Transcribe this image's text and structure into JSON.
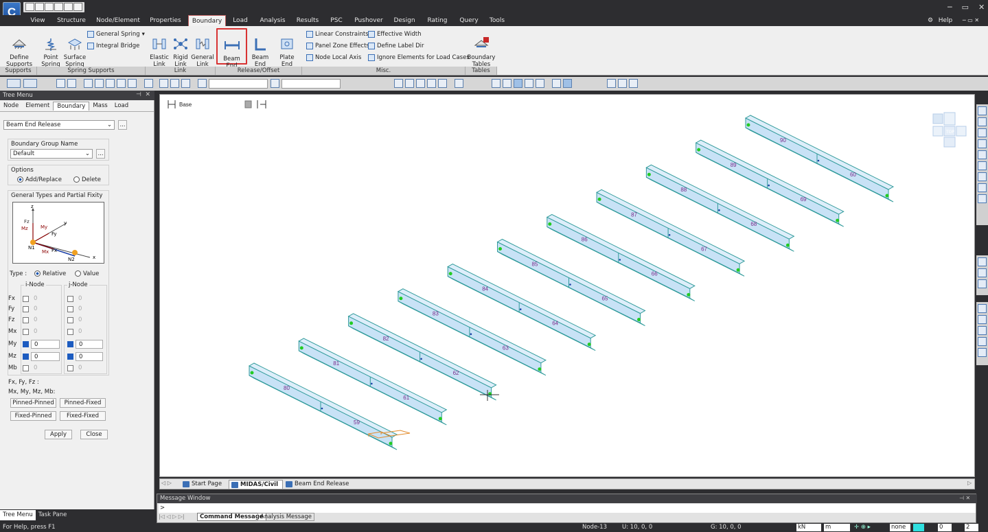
{
  "menu": {
    "items": [
      "View",
      "Structure",
      "Node/Element",
      "Properties",
      "Boundary",
      "Load",
      "Analysis",
      "Results",
      "PSC",
      "Pushover",
      "Design",
      "Rating",
      "Query",
      "Tools"
    ],
    "help": "Help"
  },
  "ribbon": {
    "define_supports": "Define\nSupports",
    "point_spring": "Point\nSpring",
    "surface_spring": "Surface\nSpring",
    "general_spring": "General Spring",
    "integral_bridge": "Integral Bridge",
    "elastic_link": "Elastic\nLink",
    "rigid_link": "Rigid\nLink",
    "general_link": "General\nLink",
    "beam_end_release": "Beam End\nRelease",
    "beam_end_offsets": "Beam End\nOffsets",
    "plate_end_release": "Plate End\nRelease",
    "linear_constraints": "Linear Constraints",
    "panel_zone_effects": "Panel Zone Effects",
    "node_local_axis": "Node Local Axis",
    "effective_width": "Effective Width",
    "define_label_dir": "Define Label Dir",
    "ignore_elements": "Ignore Elements for Load Cases",
    "boundary_tables": "Boundary\nTables",
    "groups": {
      "supports": "Supports",
      "spring_supports": "Spring Supports",
      "link": "Link",
      "release_offset": "Release/Offset",
      "misc": "Misc.",
      "tables": "Tables"
    }
  },
  "tree": {
    "title": "Tree Menu",
    "tabs": [
      "Node",
      "Element",
      "Boundary",
      "Mass",
      "Load"
    ],
    "function_select": "Beam End Release",
    "group_label": "Boundary Group Name",
    "group_value": "Default",
    "options_label": "Options",
    "opt_add": "Add/Replace",
    "opt_delete": "Delete",
    "general_types": "General Types and Partial Fixity",
    "type_label": "Type :",
    "type_relative": "Relative",
    "type_value": "Value",
    "inode": "i-Node",
    "jnode": "j-Node",
    "dofs": [
      "Fx",
      "Fy",
      "Fz",
      "Mx",
      "My",
      "Mz",
      "Mb"
    ],
    "i_values": [
      "0",
      "0",
      "0",
      "0",
      "0",
      "0",
      "0"
    ],
    "j_values": [
      "0",
      "0",
      "0",
      "0",
      "0",
      "0",
      "0"
    ],
    "legend1": "Fx, Fy, Fz     :",
    "legend2": "Mx, My, Mz, Mb:",
    "btn_pp": "Pinned-Pinned",
    "btn_pf": "Pinned-Fixed",
    "btn_fp": "Fixed-Pinned",
    "btn_ff": "Fixed-Fixed",
    "apply": "Apply",
    "close": "Close",
    "bottom_tabs": [
      "Tree Menu",
      "Task Pane"
    ]
  },
  "diagram": {
    "z": "z",
    "y": "y",
    "x": "x",
    "fz": "Fz",
    "mz": "Mz",
    "my": "My",
    "fy": "Fy",
    "fx": "Fx",
    "mx": "Mx",
    "n1": "N1",
    "n2": "N2"
  },
  "view": {
    "base": "Base",
    "top_label": "TOP",
    "tabs": [
      "Start Page",
      "MIDAS/Civil",
      "Beam End Release"
    ]
  },
  "beams": [
    {
      "a": "80",
      "b": "59"
    },
    {
      "a": "81",
      "b": "61"
    },
    {
      "a": "82",
      "b": "62"
    },
    {
      "a": "83",
      "b": "63"
    },
    {
      "a": "84",
      "b": "64"
    },
    {
      "a": "85",
      "b": "65"
    },
    {
      "a": "86",
      "b": "66"
    },
    {
      "a": "87",
      "b": "67"
    },
    {
      "a": "88",
      "b": "68"
    },
    {
      "a": "89",
      "b": "69"
    },
    {
      "a": "90",
      "b": "60"
    }
  ],
  "message": {
    "title": "Message Window",
    "prompt": ">",
    "tabs": [
      "Command Message",
      "Analysis Message"
    ]
  },
  "status": {
    "help": "For Help, press F1",
    "node": "Node-13",
    "u": "U: 10, 0, 0",
    "g": "G: 10, 0, 0",
    "unit_force": "kN",
    "unit_length": "m",
    "none": "none",
    "zero": "0",
    "two": "2"
  },
  "colors": {
    "beam_fill": "#c8e2f6",
    "beam_edge": "#2f9a9a",
    "node_green": "#22cc22",
    "label": "#7a2a8a",
    "accent": "#d83232"
  }
}
